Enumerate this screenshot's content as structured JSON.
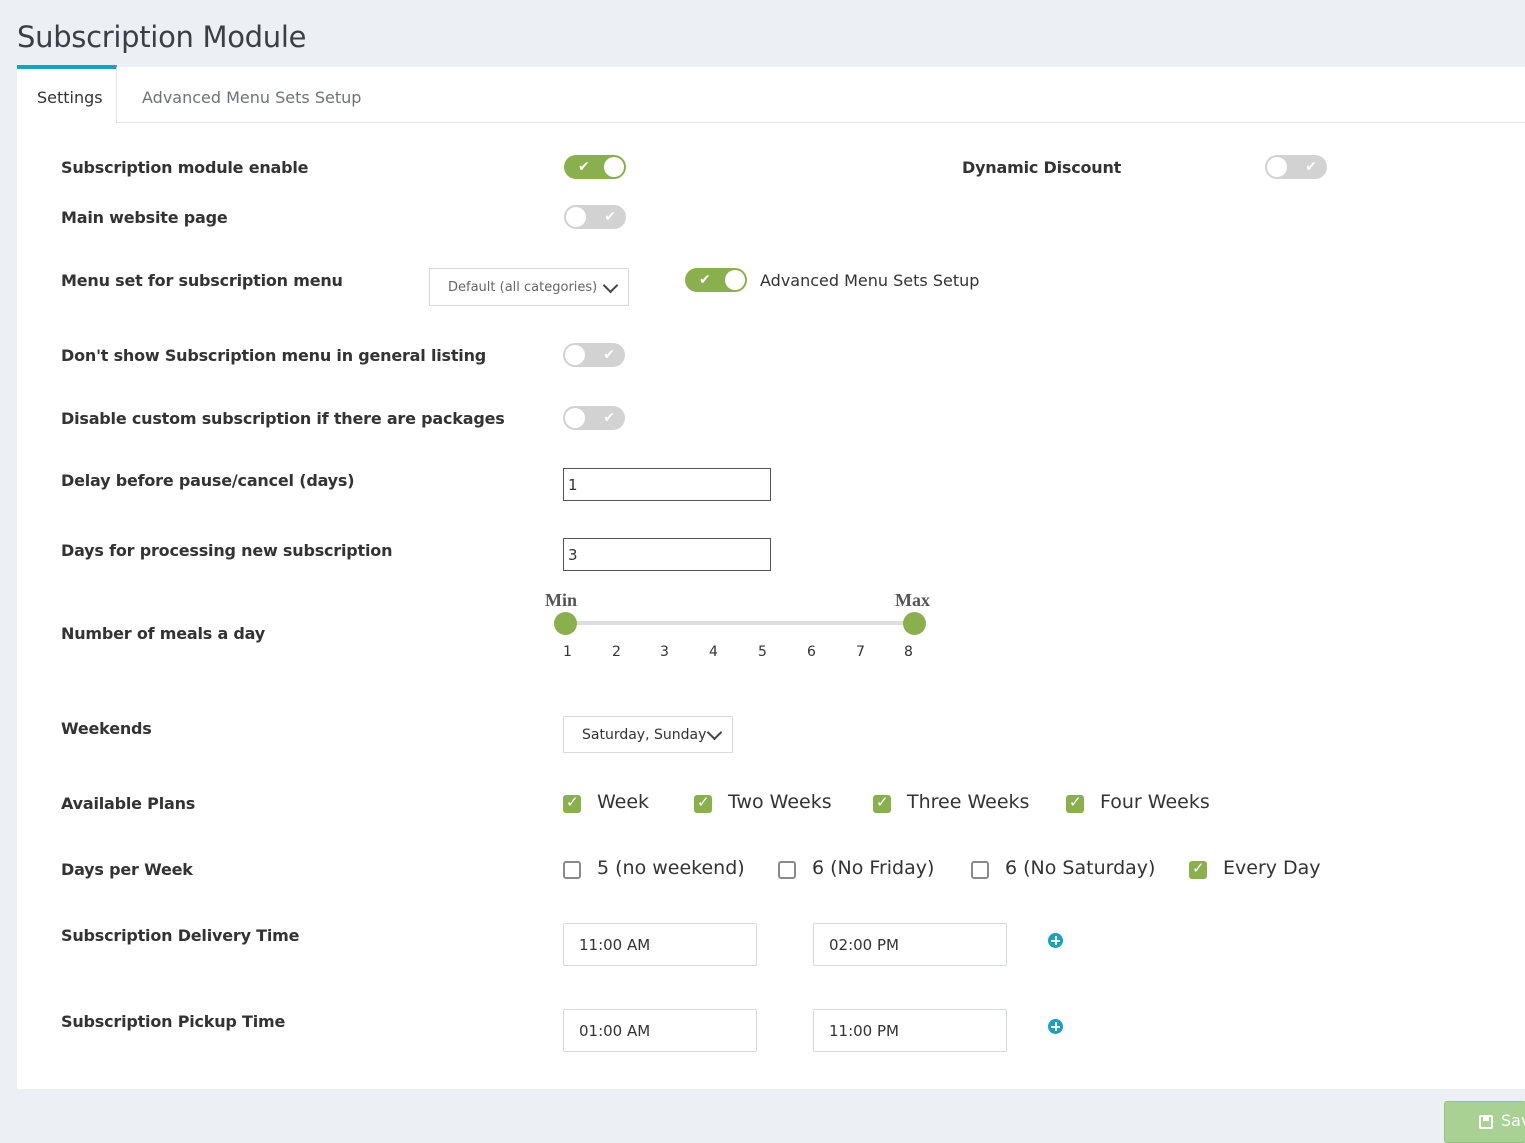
{
  "page_title": "Subscription Module",
  "tabs": [
    {
      "label": "Settings",
      "active": true
    },
    {
      "label": "Advanced Menu Sets Setup",
      "active": false
    }
  ],
  "settings": {
    "subscription_enable": {
      "label": "Subscription module enable",
      "on": true
    },
    "dynamic_discount": {
      "label": "Dynamic Discount",
      "on": false
    },
    "main_website_page": {
      "label": "Main website page",
      "on": false
    },
    "menu_set": {
      "label": "Menu set for subscription menu",
      "selected": "Default (all categories)",
      "advanced_toggle_label": "Advanced Menu Sets Setup",
      "advanced_on": true
    },
    "dont_show_menu": {
      "label": "Don't show Subscription menu in general listing",
      "on": false
    },
    "disable_custom": {
      "label": "Disable custom subscription if there are packages",
      "on": false
    },
    "delay_pause": {
      "label": "Delay before pause/cancel (days)",
      "value": "1"
    },
    "processing_days": {
      "label": "Days for processing new subscription",
      "value": "3"
    },
    "meals_per_day": {
      "label": "Number of meals a day",
      "min_caption": "Min",
      "max_caption": "Max",
      "ticks": [
        "1",
        "2",
        "3",
        "4",
        "5",
        "6",
        "7",
        "8"
      ],
      "min_value": 1,
      "max_value": 8
    },
    "weekends": {
      "label": "Weekends",
      "selected": "Saturday, Sunday"
    },
    "available_plans": {
      "label": "Available Plans",
      "options": [
        {
          "label": "Week",
          "checked": true
        },
        {
          "label": "Two Weeks",
          "checked": true
        },
        {
          "label": "Three Weeks",
          "checked": true
        },
        {
          "label": "Four Weeks",
          "checked": true
        }
      ]
    },
    "days_per_week": {
      "label": "Days per Week",
      "options": [
        {
          "label": "5 (no weekend)",
          "checked": false
        },
        {
          "label": "6 (No Friday)",
          "checked": false
        },
        {
          "label": "6 (No Saturday)",
          "checked": false
        },
        {
          "label": "Every Day",
          "checked": true
        }
      ]
    },
    "delivery_time": {
      "label": "Subscription Delivery Time",
      "from": "11:00 AM",
      "to": "02:00 PM"
    },
    "pickup_time": {
      "label": "Subscription Pickup Time",
      "from": "01:00 AM",
      "to": "11:00 PM"
    }
  },
  "save_button": {
    "label": "Save"
  },
  "colors": {
    "accent": "#17a2c2",
    "toggle_on": "#8ab04e",
    "toggle_off": "#d2d2d2"
  }
}
